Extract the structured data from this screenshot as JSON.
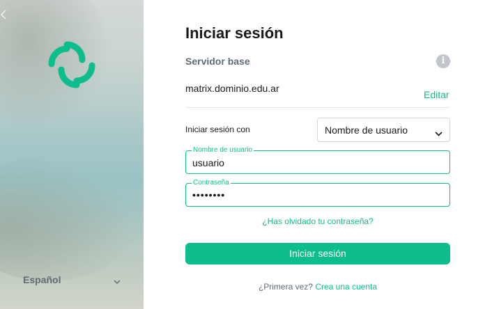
{
  "sidebar": {
    "language": "Español",
    "logo": "element-logo",
    "accent": "#0dbd8b"
  },
  "login": {
    "title": "Iniciar sesión",
    "server_label": "Servidor base",
    "server_value": "matrix.dominio.edu.ar",
    "edit_label": "Editar",
    "login_with_label": "Iniciar sesión con",
    "login_with_selected": "Nombre de usuario",
    "username_label": "Nombre de usuario",
    "username_value": "usuario",
    "password_label": "Contraseña",
    "password_value": "••••••••",
    "forgot_password": "¿Has olvidado tu contraseña?",
    "submit_label": "Iniciar sesión",
    "first_time": "¿Primera vez?",
    "create_account": "Crea una cuenta"
  },
  "icons": {
    "info": "info-icon",
    "chevron": "chevron-down-icon"
  }
}
